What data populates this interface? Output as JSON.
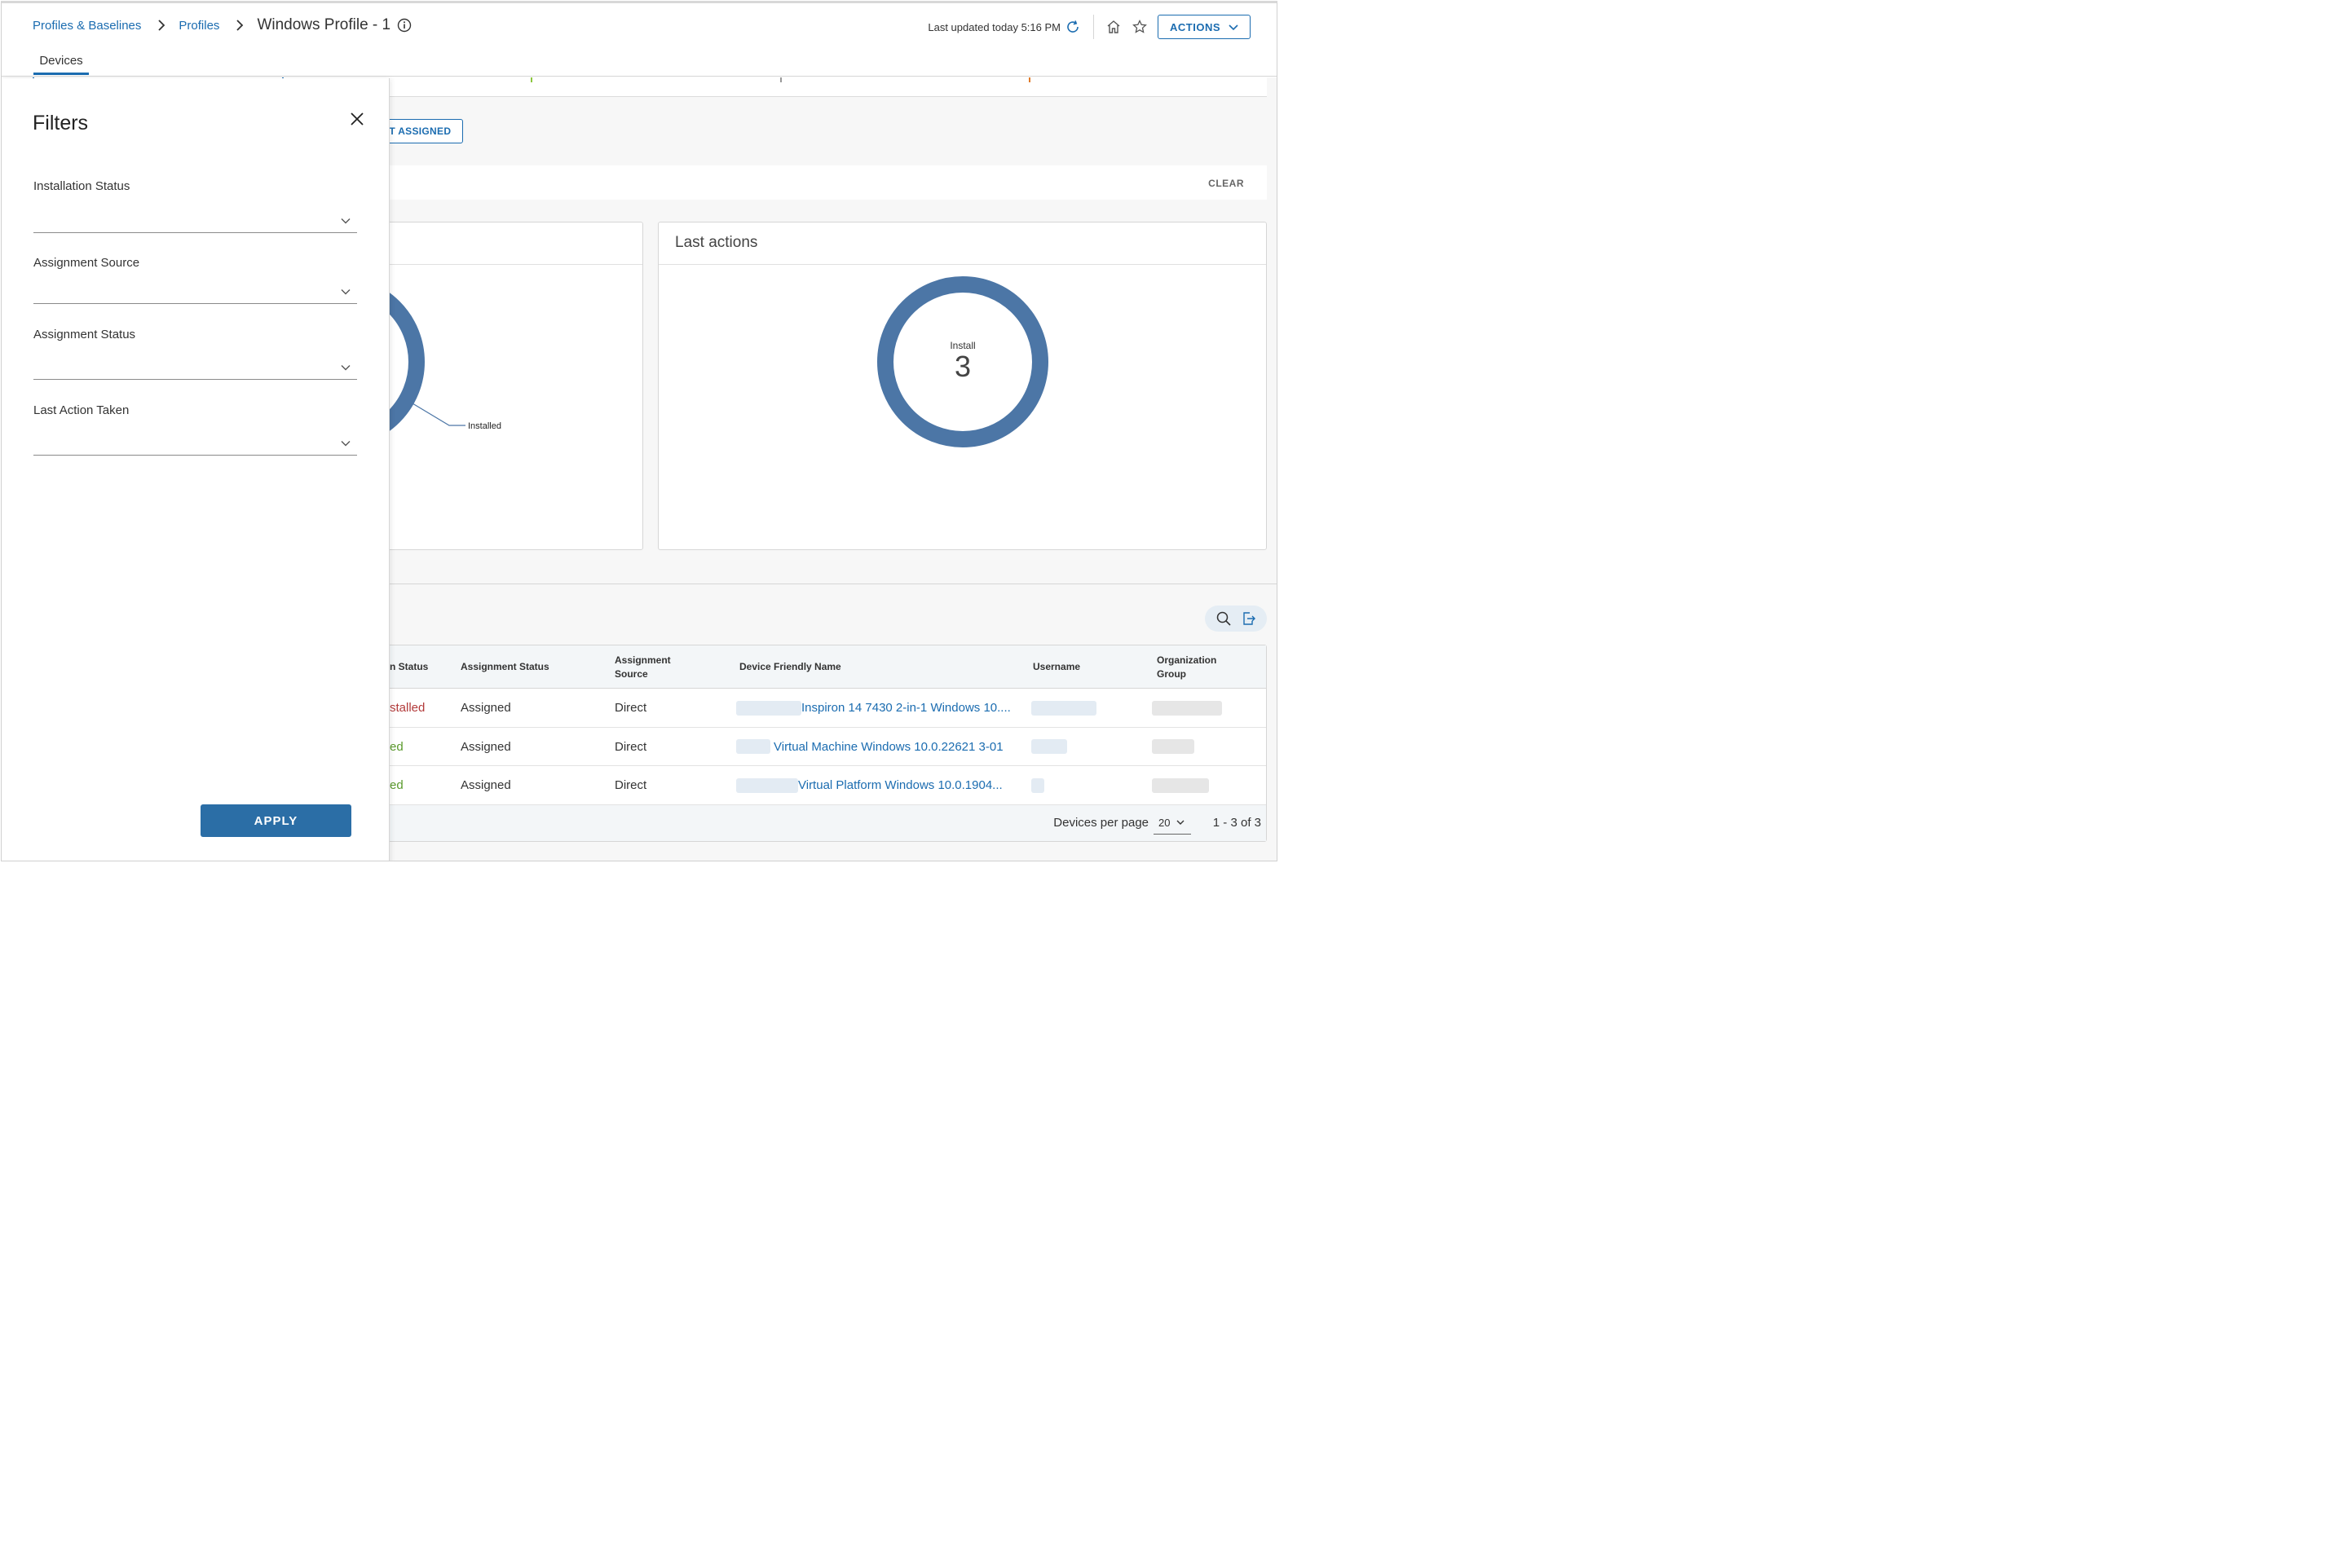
{
  "header": {
    "breadcrumb": [
      "Profiles & Baselines",
      "Profiles",
      "Windows Profile - 1"
    ],
    "last_updated": "Last updated today 5:16 PM",
    "actions_label": "ACTIONS"
  },
  "tabs": [
    {
      "label": "Devices",
      "active": true
    }
  ],
  "pill_button_label": "D BUT NOT ASSIGNED",
  "clear_label": "CLEAR",
  "charts": {
    "left": {
      "title": "",
      "label": "Installed"
    },
    "right": {
      "title": "Last actions",
      "center_label": "Install",
      "center_value": "3"
    }
  },
  "chart_data": {
    "type": "pie",
    "title": "Last actions",
    "categories": [
      "Install"
    ],
    "values": [
      3
    ]
  },
  "table": {
    "columns": [
      "n Status",
      "Assignment Status",
      "Assignment Source",
      "Device Friendly Name",
      "Username",
      "Organization Group"
    ],
    "rows": [
      {
        "status": "stalled",
        "status_color": "#b23a3a",
        "assignment_status": "Assigned",
        "assignment_source": "Direct",
        "device": "Inspiron 14 7430 2-in-1 Windows 10...."
      },
      {
        "status": "ed",
        "status_color": "#5a9a2c",
        "assignment_status": "Assigned",
        "assignment_source": "Direct",
        "device": "Virtual Machine Windows 10.0.22621 3-01"
      },
      {
        "status": "ed",
        "status_color": "#5a9a2c",
        "assignment_status": "Assigned",
        "assignment_source": "Direct",
        "device": "Virtual Platform Windows 10.0.1904..."
      }
    ],
    "per_page_label": "Devices per page",
    "per_page_value": "20",
    "pager_text": "1 - 3 of 3"
  },
  "filters": {
    "title": "Filters",
    "fields": [
      {
        "label": "Installation Status",
        "value": ""
      },
      {
        "label": "Assignment Source",
        "value": ""
      },
      {
        "label": "Assignment Status",
        "value": ""
      },
      {
        "label": "Last Action Taken",
        "value": ""
      }
    ],
    "apply_label": "APPLY"
  },
  "colors": {
    "accent": "#1b6cb0",
    "donut": "#4c76a6",
    "apply": "#2b6ea6"
  }
}
